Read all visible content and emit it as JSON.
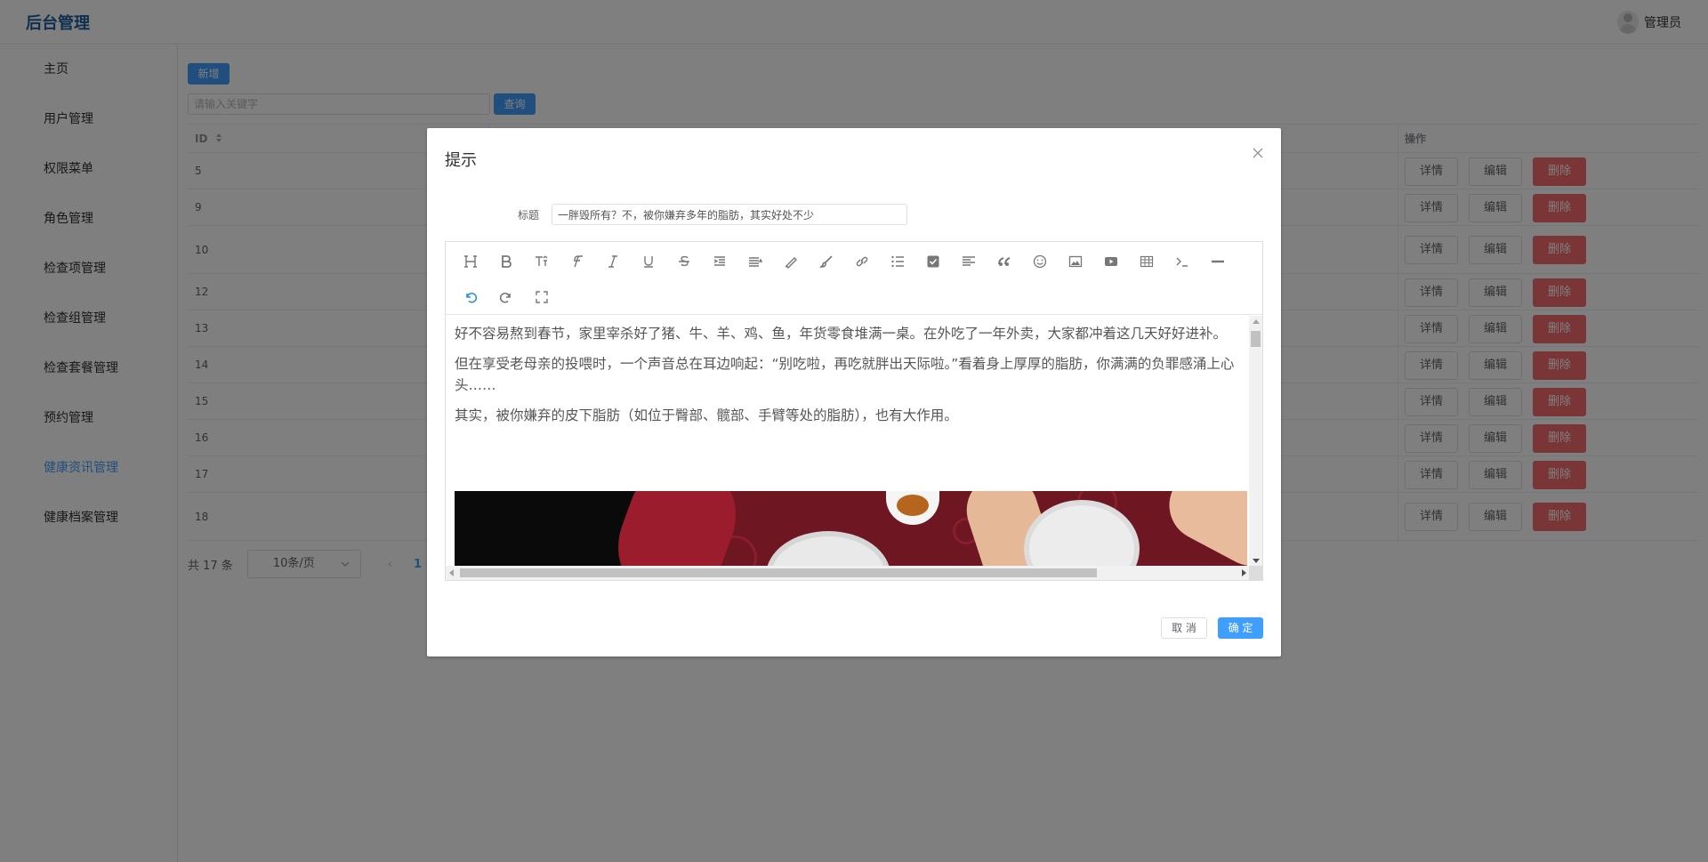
{
  "header": {
    "brand": "后台管理",
    "user": "管理员"
  },
  "sidebar": {
    "items": [
      {
        "label": "主页"
      },
      {
        "label": "用户管理"
      },
      {
        "label": "权限菜单"
      },
      {
        "label": "角色管理"
      },
      {
        "label": "检查项管理"
      },
      {
        "label": "检查组管理"
      },
      {
        "label": "检查套餐管理"
      },
      {
        "label": "预约管理"
      },
      {
        "label": "健康资讯管理"
      },
      {
        "label": "健康档案管理"
      }
    ],
    "active_index": 8
  },
  "toolbar": {
    "add_label": "新增",
    "search_placeholder": "请输入关键字",
    "search_label": "查询"
  },
  "table": {
    "headers": {
      "id": "ID",
      "ops": "操作"
    },
    "op_labels": {
      "detail": "详情",
      "edit": "编辑",
      "delete": "删除"
    },
    "rows": [
      "5",
      "9",
      "10",
      "12",
      "13",
      "14",
      "15",
      "16",
      "17",
      "18"
    ]
  },
  "pagination": {
    "total": "共 17 条",
    "page_size": "10条/页",
    "current_page": "1"
  },
  "dialog": {
    "title": "提示",
    "form_label": "标题",
    "title_value": "一胖毁所有？不，被你嫌弃多年的脂肪，其实好处不少",
    "content": [
      "好不容易熬到春节，家里宰杀好了猪、牛、羊、鸡、鱼，年货零食堆满一桌。在外吃了一年外卖，大家都冲着这几天好好进补。",
      "但在享受老母亲的投喂时，一个声音总在耳边响起：“别吃啦，再吃就胖出天际啦。”看着身上厚厚的脂肪，你满满的负罪感涌上心头……",
      "其实，被你嫌弃的皮下脂肪（如位于臀部、髋部、手臂等处的脂肪），也有大作用。"
    ],
    "cancel_label": "取 消",
    "ok_label": "确 定"
  },
  "colors": {
    "primary": "#409eff",
    "danger": "#f56c6c",
    "brand": "#1f5f9e"
  }
}
